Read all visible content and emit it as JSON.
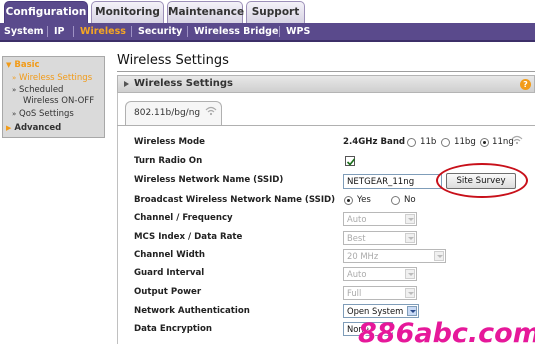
{
  "top_tabs": [
    "Configuration",
    "Monitoring",
    "Maintenance",
    "Support"
  ],
  "subnav": [
    "System",
    "IP",
    "Wireless",
    "Security",
    "Wireless Bridge",
    "WPS"
  ],
  "sidebar": {
    "basic": "Basic",
    "items": [
      "Wireless Settings",
      "Scheduled",
      "Wireless ON-OFF",
      "QoS Settings"
    ],
    "advanced": "Advanced"
  },
  "page_title": "Wireless Settings",
  "section_title": "Wireless Settings",
  "help_icon": "?",
  "band_tab": "802.11b/bg/ng",
  "form": {
    "wireless_mode_label": "Wireless Mode",
    "band_label": "2.4GHz Band",
    "mode_options": [
      "11b",
      "11bg",
      "11ng"
    ],
    "mode_selected": "11ng",
    "turn_radio_label": "Turn Radio On",
    "turn_radio_checked": true,
    "ssid_label": "Wireless Network Name (SSID)",
    "ssid_value": "NETGEAR_11ng",
    "site_survey_label": "Site Survey",
    "broadcast_label": "Broadcast Wireless Network Name (SSID)",
    "broadcast_options": [
      "Yes",
      "No"
    ],
    "broadcast_selected": "Yes",
    "channel_label": "Channel / Frequency",
    "channel_value": "Auto",
    "mcs_label": "MCS Index / Data Rate",
    "mcs_value": "Best",
    "width_label": "Channel Width",
    "width_value": "20 MHz",
    "guard_label": "Guard Interval",
    "guard_value": "Auto",
    "power_label": "Output Power",
    "power_value": "Full",
    "auth_label": "Network Authentication",
    "auth_value": "Open System",
    "enc_label": "Data Encryption",
    "enc_value": "None"
  },
  "watermark": "886abc.com",
  "colors": {
    "nav_purple": "#5a4a8c",
    "accent_orange": "#f29b18",
    "highlight_red": "#c8101a",
    "watermark_pink": "#e6189a"
  },
  "icons": [
    "help-icon",
    "wifi-icon",
    "checkmark-icon",
    "dropdown-caret-icon"
  ]
}
